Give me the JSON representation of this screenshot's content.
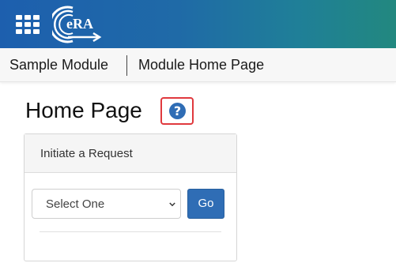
{
  "header": {
    "apps_icon": "grid-icon",
    "logo_text": "eRA",
    "colors": {
      "gradient_start": "#1d5fae",
      "gradient_end": "#22887f"
    }
  },
  "breadcrumb": {
    "items": [
      {
        "label": "Sample Module"
      },
      {
        "label": "Module Home Page"
      }
    ]
  },
  "page": {
    "title": "Home Page",
    "help_icon": "question-circle-icon",
    "help_symbol": "?",
    "colors": {
      "help_outline": "#e0393e",
      "accent": "#2f6db5"
    }
  },
  "request_panel": {
    "title": "Initiate a Request",
    "select": {
      "selected_label": "Select One"
    },
    "go_label": "Go"
  }
}
